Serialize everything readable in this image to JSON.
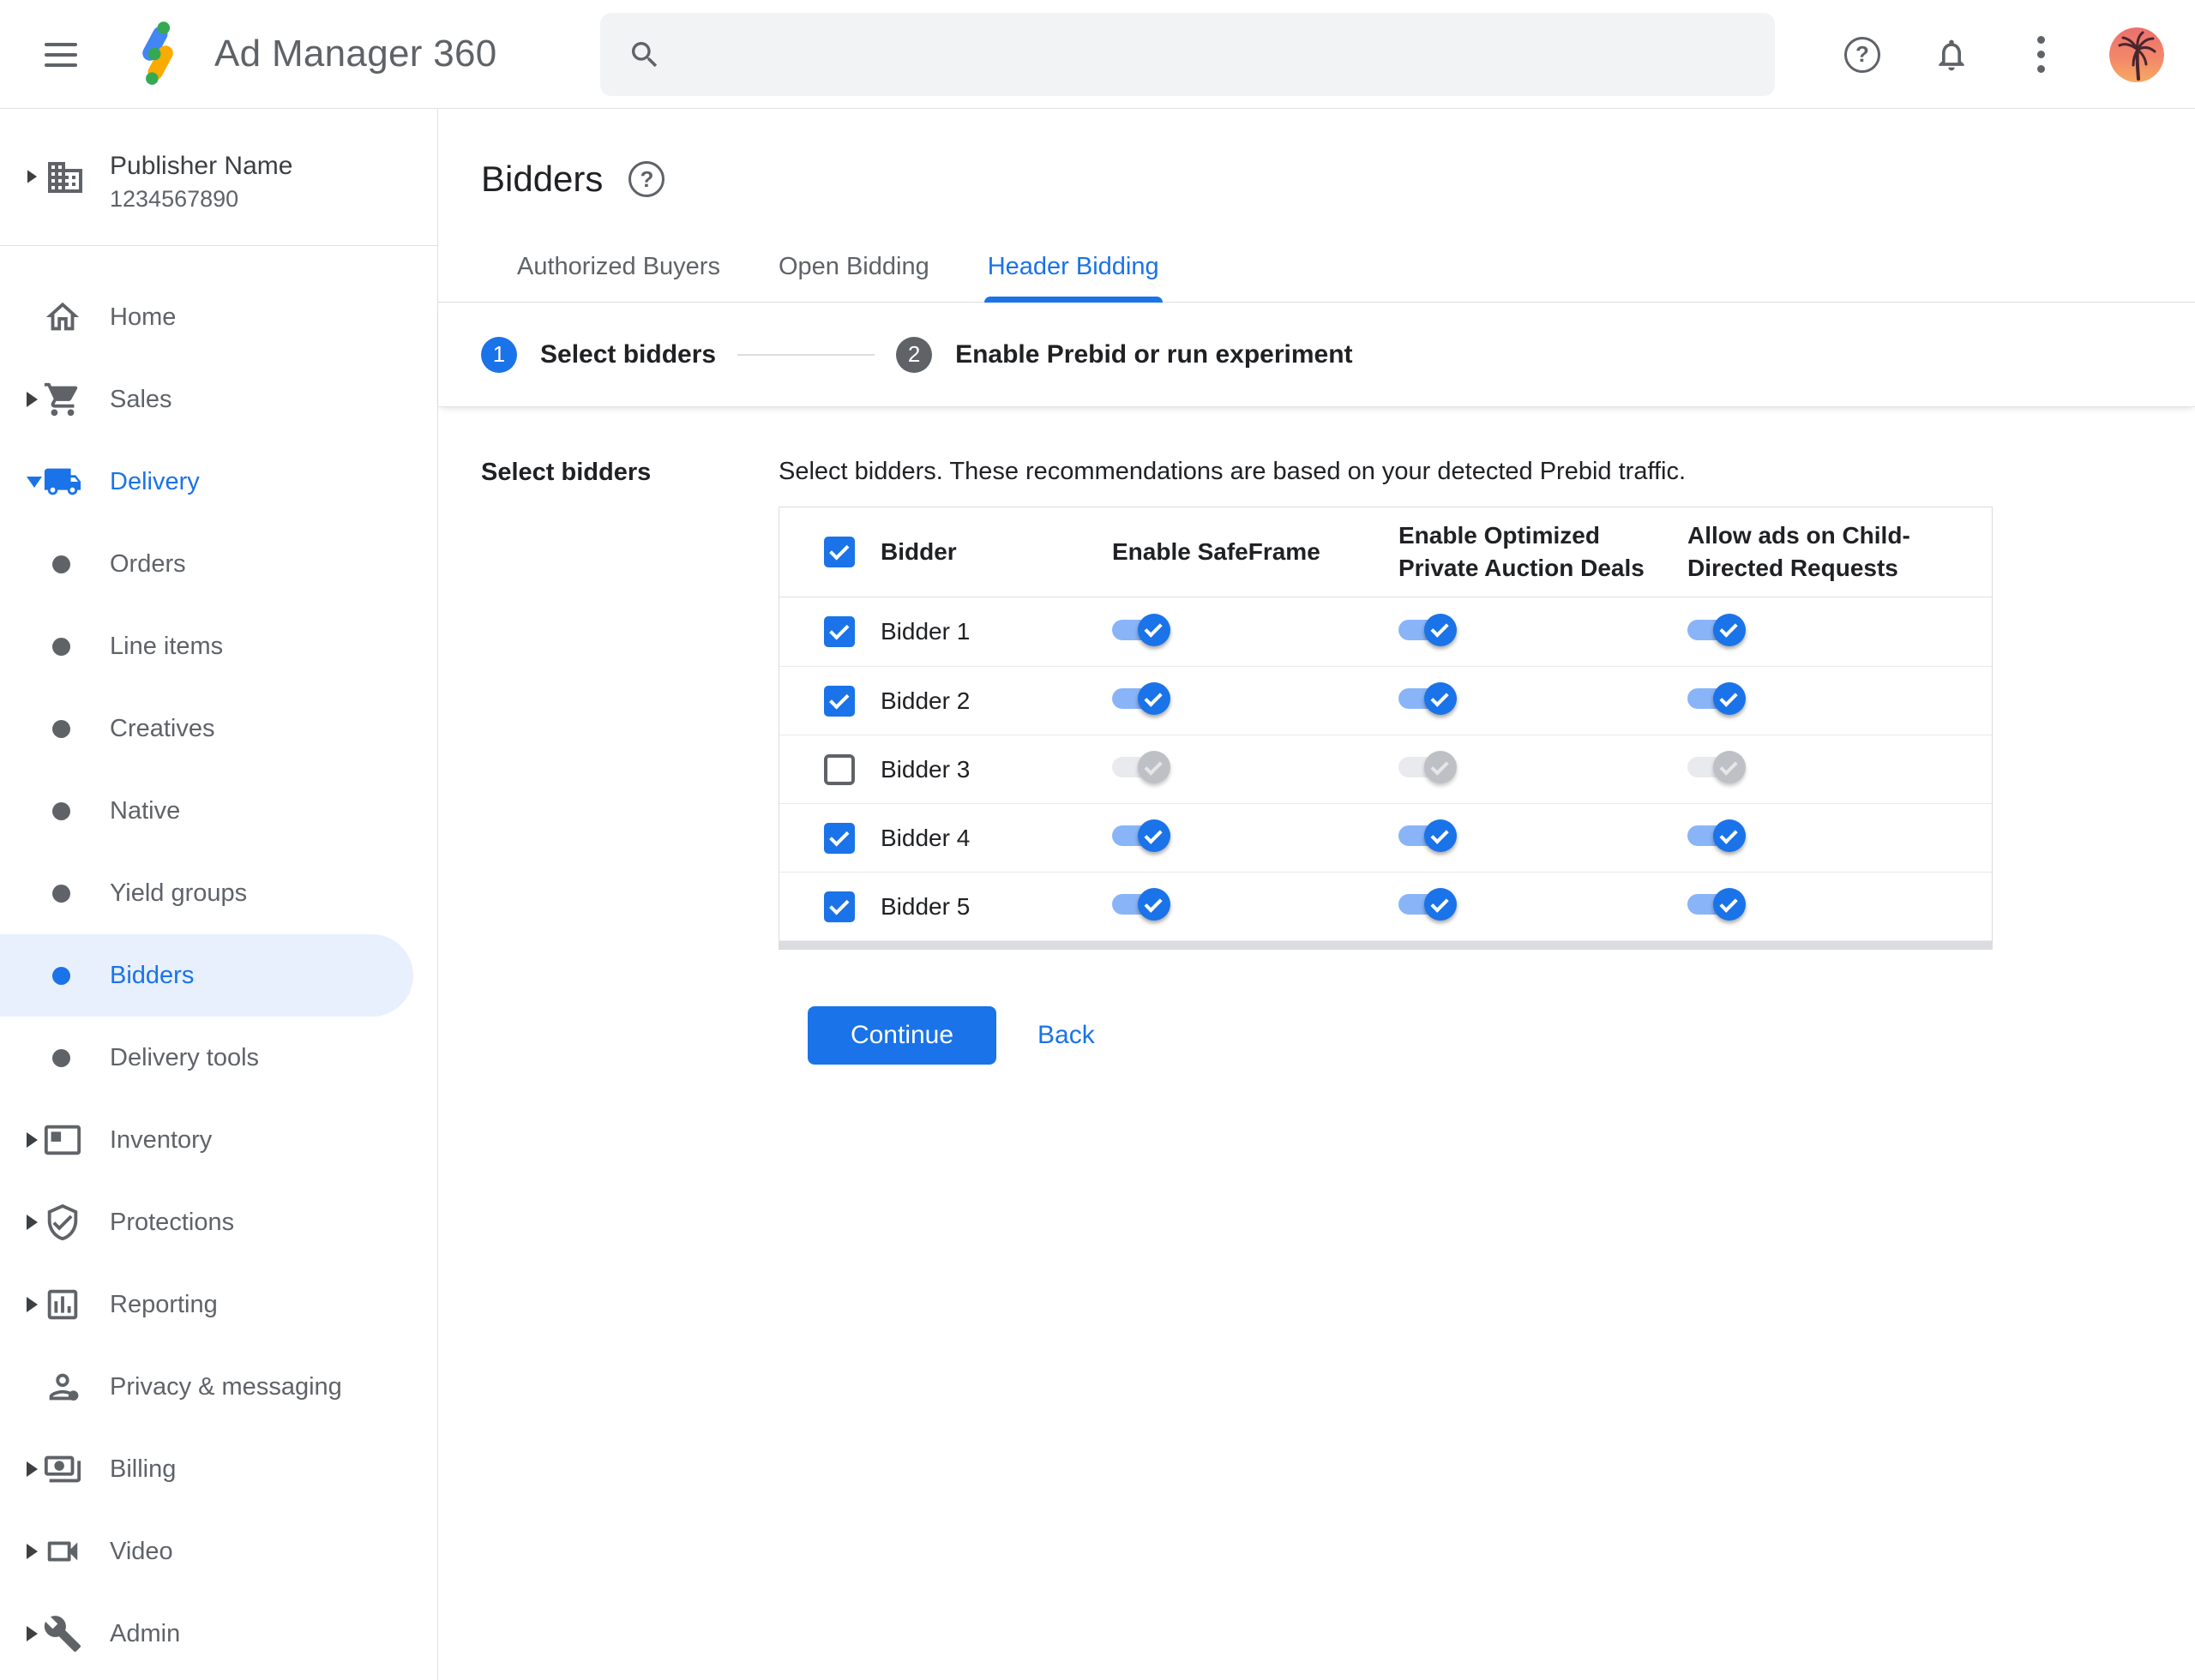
{
  "colors": {
    "accent": "#1a73e8",
    "toggle_track_on": "#8ab4f8",
    "toggle_track_off": "#e9eaee",
    "toggle_thumb_off": "#bdc1c6",
    "selected_item_bg": "#e8f0fe",
    "border": "#dadce0",
    "text": "#202124",
    "muted_text": "#5f6368"
  },
  "topbar": {
    "app_name": "Ad Manager 360",
    "search_placeholder": "",
    "search_value": "",
    "icons": [
      "menu-icon",
      "ad-manager-logo",
      "search-icon",
      "help-icon",
      "notifications-icon",
      "more-vert-icon",
      "avatar"
    ]
  },
  "sidebar": {
    "publisher": {
      "name": "Publisher Name",
      "id": "1234567890",
      "icon": "building-icon",
      "arrow": "collapsed"
    },
    "items": [
      {
        "label": "Home",
        "icon": "home-icon",
        "arrow": "none",
        "indent": 0
      },
      {
        "label": "Sales",
        "icon": "cart-icon",
        "arrow": "collapsed",
        "indent": 0
      },
      {
        "label": "Delivery",
        "icon": "truck-icon",
        "arrow": "expanded",
        "indent": 0,
        "state": "open"
      },
      {
        "label": "Orders",
        "icon": "bullet",
        "arrow": "none",
        "indent": 1
      },
      {
        "label": "Line items",
        "icon": "bullet",
        "arrow": "none",
        "indent": 1
      },
      {
        "label": "Creatives",
        "icon": "bullet",
        "arrow": "none",
        "indent": 1
      },
      {
        "label": "Native",
        "icon": "bullet",
        "arrow": "none",
        "indent": 1
      },
      {
        "label": "Yield groups",
        "icon": "bullet",
        "arrow": "none",
        "indent": 1
      },
      {
        "label": "Bidders",
        "icon": "bullet",
        "arrow": "none",
        "indent": 1,
        "state": "selected"
      },
      {
        "label": "Delivery tools",
        "icon": "bullet",
        "arrow": "none",
        "indent": 1
      },
      {
        "label": "Inventory",
        "icon": "inventory-icon",
        "arrow": "collapsed",
        "indent": 0
      },
      {
        "label": "Protections",
        "icon": "shield-icon",
        "arrow": "collapsed",
        "indent": 0
      },
      {
        "label": "Reporting",
        "icon": "report-icon",
        "arrow": "collapsed",
        "indent": 0
      },
      {
        "label": "Privacy & messaging",
        "icon": "privacy-icon",
        "arrow": "none",
        "indent": 0
      },
      {
        "label": "Billing",
        "icon": "billing-icon",
        "arrow": "collapsed",
        "indent": 0
      },
      {
        "label": "Video",
        "icon": "video-icon",
        "arrow": "collapsed",
        "indent": 0
      },
      {
        "label": "Admin",
        "icon": "admin-icon",
        "arrow": "collapsed",
        "indent": 0
      }
    ]
  },
  "page": {
    "title": "Bidders",
    "help_icon": "help-icon"
  },
  "tabs": [
    {
      "label": "Authorized Buyers",
      "active": false
    },
    {
      "label": "Open Bidding",
      "active": false
    },
    {
      "label": "Header Bidding",
      "active": true
    }
  ],
  "stepper": [
    {
      "number": "1",
      "label": "Select bidders",
      "state": "active"
    },
    {
      "number": "2",
      "label": "Enable Prebid or run experiment",
      "state": "upcoming"
    }
  ],
  "section": {
    "label": "Select bidders",
    "description": "Select bidders. These recommendations are based on your detected Prebid traffic."
  },
  "table": {
    "select_all_checked": true,
    "columns": [
      "Bidder",
      "Enable SafeFrame",
      "Enable Optimized Private Auction Deals",
      "Allow ads on Child-Directed Requests"
    ],
    "rows": [
      {
        "name": "Bidder 1",
        "checked": true,
        "safeframe": true,
        "optimized": true,
        "child_directed": true
      },
      {
        "name": "Bidder 2",
        "checked": true,
        "safeframe": true,
        "optimized": true,
        "child_directed": true
      },
      {
        "name": "Bidder 3",
        "checked": false,
        "safeframe": false,
        "optimized": false,
        "child_directed": false
      },
      {
        "name": "Bidder 4",
        "checked": true,
        "safeframe": true,
        "optimized": true,
        "child_directed": true
      },
      {
        "name": "Bidder 5",
        "checked": true,
        "safeframe": true,
        "optimized": true,
        "child_directed": true
      }
    ]
  },
  "actions": {
    "continue_label": "Continue",
    "back_label": "Back"
  }
}
